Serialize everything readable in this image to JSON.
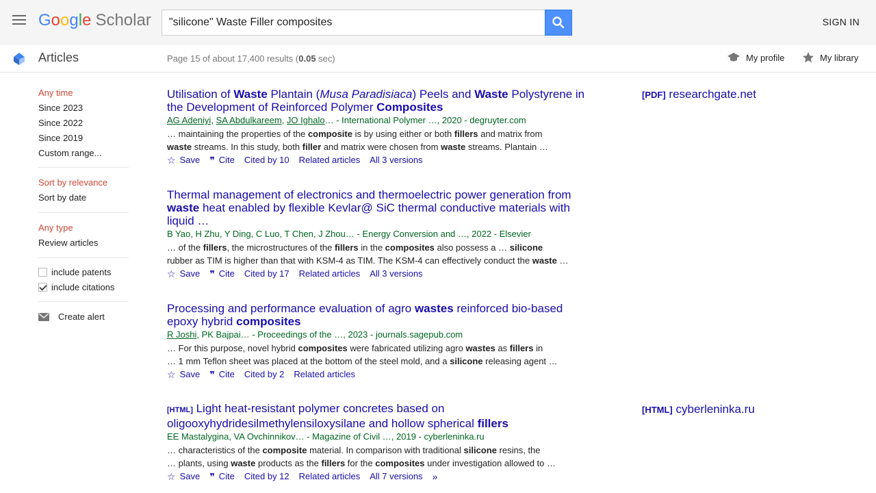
{
  "header": {
    "logo_parts": [
      "G",
      "o",
      "o",
      "g",
      "l",
      "e"
    ],
    "logo_scholar": "Scholar",
    "search_value": "\"silicone\" Waste Filler composites",
    "signin": "SIGN IN"
  },
  "subbar": {
    "section": "Articles",
    "results_prefix": "Page 15 of about 17,400 results (",
    "results_time": "0.05",
    "results_suffix": " sec)",
    "my_profile": "My profile",
    "my_library": "My library"
  },
  "sidebar": {
    "time_filters": [
      "Any time",
      "Since 2023",
      "Since 2022",
      "Since 2019",
      "Custom range..."
    ],
    "sort_options": [
      "Sort by relevance",
      "Sort by date"
    ],
    "type_options": [
      "Any type",
      "Review articles"
    ],
    "include_patents": "include patents",
    "include_citations": "include citations",
    "create_alert": "Create alert"
  },
  "actions": {
    "save": "Save",
    "cite": "Cite"
  },
  "results": [
    {
      "title_parts": [
        "Utilisation of ",
        "Waste",
        " Plantain (",
        "Musa Paradisiaca",
        ") Peels and ",
        "Waste",
        " Polystyrene in the Development of Reinforced Polymer ",
        "Composites"
      ],
      "authors_linked": [
        "AG Adeniyi",
        "SA Abdulkareem",
        "JO Ighalo"
      ],
      "meta_rest": "… - International Polymer …, 2020 - degruyter.com",
      "snippet1": [
        "… maintaining the properties of the ",
        "composite",
        " is by using either or both ",
        "fillers",
        " and matrix from"
      ],
      "snippet2": [
        "waste",
        " streams. In this study, both ",
        "filler",
        " and matrix were chosen from ",
        "waste",
        " streams. Plantain …"
      ],
      "cited_by": "Cited by 10",
      "related": "Related articles",
      "versions": "All 3 versions",
      "side_tag": "[PDF]",
      "side_source": "researchgate.net"
    },
    {
      "title_parts": [
        "Thermal management of electronics and thermoelectric power generation from ",
        "waste",
        " heat enabled by flexible Kevlar@ SiC thermal conductive materials with liquid …"
      ],
      "meta": "B Yao, H Zhu, Y Ding, C Luo, T Chen, J Zhou… - Energy Conversion and …, 2022 - Elsevier",
      "snippet1": [
        "… of the ",
        "fillers",
        ", the microstructures of the ",
        "fillers",
        " in the ",
        "composites",
        " also possess a … ",
        "silicone"
      ],
      "snippet2": [
        "rubber as TIM is higher than that with KSM-4 as TIM. The KSM-4 can effectively conduct the ",
        "waste",
        " …"
      ],
      "cited_by": "Cited by 17",
      "related": "Related articles",
      "versions": "All 3 versions"
    },
    {
      "title_parts": [
        "Processing and performance evaluation of agro ",
        "wastes",
        " reinforced bio-based epoxy hybrid ",
        "composites"
      ],
      "author_linked": "R Joshi",
      "meta_rest": ", PK Bajpai… - Proceedings of the …, 2023 - journals.sagepub.com",
      "snippet1": [
        "… For this purpose, novel hybrid ",
        "composites",
        " were fabricated utilizing agro ",
        "wastes",
        " as ",
        "fillers",
        " in"
      ],
      "snippet2": [
        "… 1 mm Teflon sheet was placed at the bottom of the steel mold, and a ",
        "silicone",
        " releasing agent …"
      ],
      "cited_by": "Cited by 2",
      "related": "Related articles"
    },
    {
      "title_tag": "[HTML]",
      "title_parts": [
        " Light heat-resistant polymer concretes based on oligooxyhydridesilmethylensiloxysilane and hollow spherical ",
        "fillers"
      ],
      "meta": "EE Mastalygina, VA Ovchinnikov… - Magazine of Civil …, 2019 - cyberleninka.ru",
      "snippet1": [
        "… characteristics of the ",
        "composite",
        " material. In comparison with traditional ",
        "silicone",
        " resins, the"
      ],
      "snippet2": [
        "… plants, using ",
        "waste",
        " products as the ",
        "fillers",
        " for the ",
        "composites",
        " under investigation allowed to …"
      ],
      "cited_by": "Cited by 12",
      "related": "Related articles",
      "versions": "All 7 versions",
      "side_tag": "[HTML]",
      "side_source": "cyberleninka.ru"
    }
  ]
}
